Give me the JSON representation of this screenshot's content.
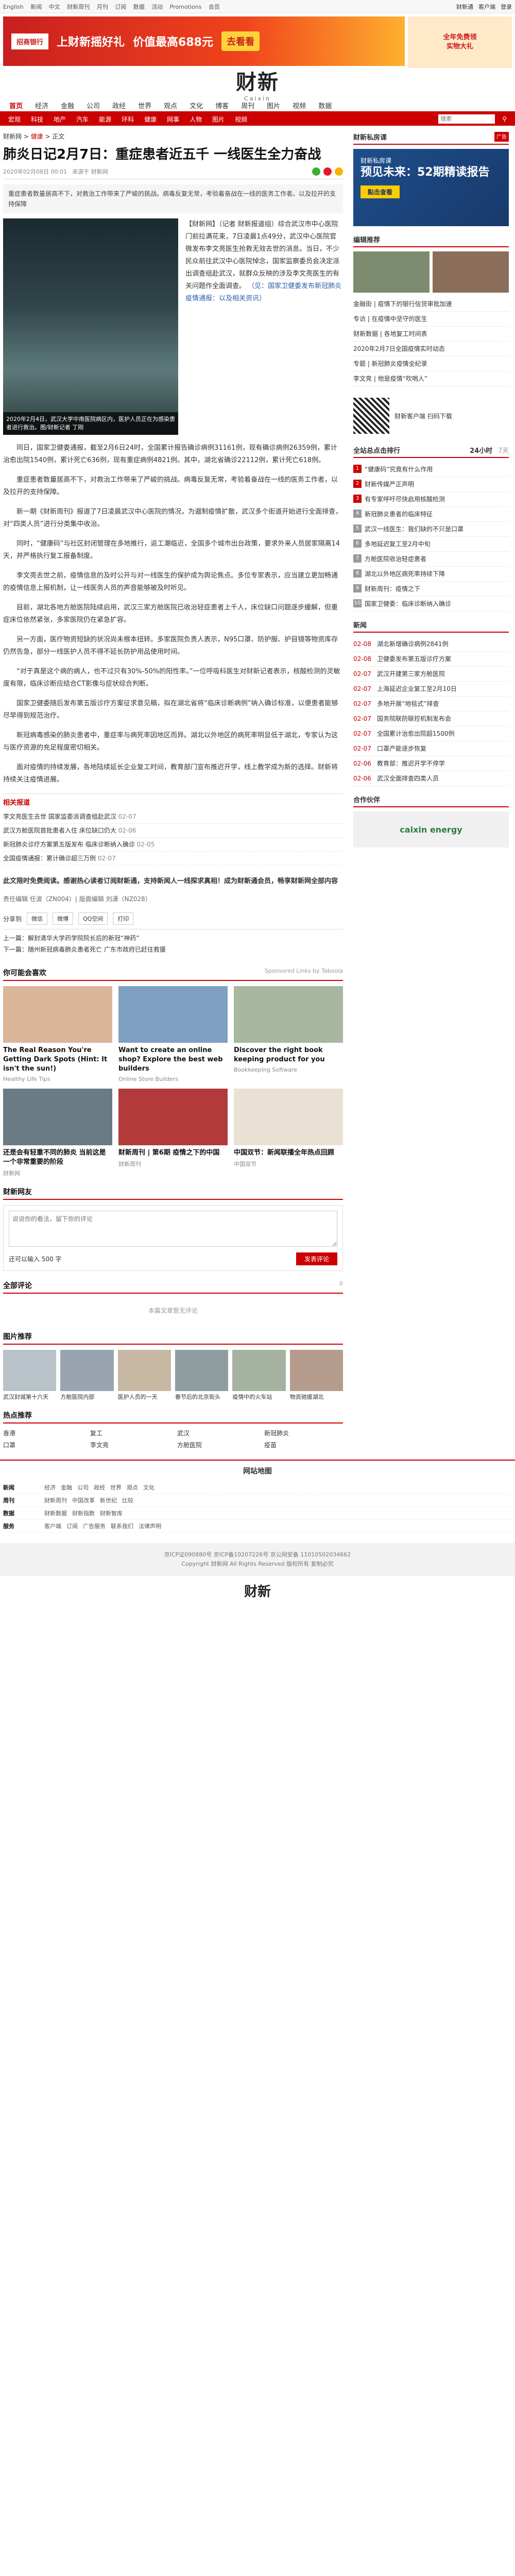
{
  "topbar": {
    "links": [
      "English",
      "新闻",
      "中文",
      "财新周刊",
      "月刊",
      "订阅",
      "数据",
      "活动",
      "Promotions",
      "会员",
      "登录"
    ],
    "right": [
      "财新通",
      "客户端",
      "登录"
    ]
  },
  "ad": {
    "bank": "招商银行",
    "slogan": "上财新摇好礼",
    "prize": "价值最高688元",
    "cta": "去看看",
    "right_line1": "全年免费领",
    "right_line2": "实物大礼"
  },
  "masthead": {
    "logo": "财新",
    "sub": "Caixin"
  },
  "nav1": {
    "items": [
      "首页",
      "经济",
      "金融",
      "公司",
      "政经",
      "世界",
      "观点",
      "文化",
      "博客",
      "周刊",
      "图片",
      "视频",
      "数据"
    ],
    "active": 0
  },
  "nav2": {
    "items": [
      "宏观",
      "科技",
      "地产",
      "汽车",
      "能源",
      "环科",
      "健康",
      "网事",
      "人物",
      "图片",
      "视频"
    ],
    "search_placeholder": "搜索"
  },
  "article": {
    "crumb_prefix": "财新网 > ",
    "crumb_section": "健康",
    "crumb_suffix": " > 正文",
    "title": "肺炎日记2月7日：重症患者近五千 一线医生全力奋战",
    "date": "2020年02月08日 00:01",
    "source": "来源于 财新网",
    "summary": "重症患者数量居高不下，对救治工作带来了严峻的挑战。病毒反复无常，考验着奋战在一线的医务工作者。以及拉开的支持保障",
    "photo_caption": "2020年2月4日，武汉大学中南医院病区内，医护人员正在为感染患者进行救治。图/财新记者 丁刚",
    "lead": "【财新网】（记者 财新报道组）综合武汉市中心医院门前拉满花束，7日凌晨1点49分，武汉中心医院官微发布李文亮医生抢救无效去世的消息。当日，不少民众前往武汉中心医院悼念，国家监察委员会决定派出调查组赴武汉，就群众反映的涉及李文亮医生的有关问题作全面调查。",
    "lead_link": "（见：国家卫健委发布新冠肺炎疫情通报：以及相关资讯）",
    "paras": [
      "同日，国家卫健委通报，截至2月6日24时，全国累计报告确诊病例31161例，现有确诊病例26359例，累计治愈出院1540例，累计死亡636例，现有重症病例4821例。其中，湖北省确诊22112例，累计死亡618例。",
      "重症患者数量居高不下，对救治工作带来了严峻的挑战。病毒反复无常，考验着奋战在一线的医务工作者，以及拉开的支持保障。",
      "新一期《财新周刊》报道了7日凌晨武汉中心医院的情况，为遏制疫情扩散，武汉多个街道开始进行全面排查，对“四类人员”进行分类集中收治。",
      "同时，“健康码”与社区封闭管理在多地推行，返工潮临近，全国多个城市出台政策，要求外来人员居家隔离14天，并严格执行复工报备制度。",
      "李文亮去世之前，疫情信息的及时公开与对一线医生的保护成为舆论焦点。多位专家表示，应当建立更加畅通的疫情信息上报机制，让一线医务人员的声音能够被及时听见。",
      "目前，湖北各地方舱医院陆续启用，武汉三家方舱医院已收治轻症患者上千人，床位缺口问题逐步缓解，但重症床位依然紧张，多家医院仍在紧急扩容。",
      "另一方面，医疗物资短缺的状况尚未根本扭转。多家医院负责人表示，N95口罩、防护服、护目镜等物资库存仍然告急，部分一线医护人员不得不延长防护用品使用时间。",
      "“对于真是这个病的病人，也不过只有30%-50%的阳性率。”一位呼吸科医生对财新记者表示，核酸检测的灵敏度有限，临床诊断应结合CT影像与症状综合判断。",
      "国家卫健委随后发布第五版诊疗方案征求意见稿，拟在湖北省将“临床诊断病例”纳入确诊标准，以便患者能够尽早得到规范治疗。",
      "新冠病毒感染的肺炎患者中，重症率与病死率因地区而异。湖北以外地区的病死率明显低于湖北，专家认为这与医疗资源的充足程度密切相关。",
      "面对疫情的持续发展，各地陆续延长企业复工时间，教育部门宣布推迟开学，线上教学成为新的选择。财新将持续关注疫情进展。"
    ],
    "related_title": "相关报道",
    "related": [
      {
        "t": "李文亮医生去世 国家监委派调查组赴武汉",
        "d": "02-07"
      },
      {
        "t": "武汉方舱医院首批患者入住 床位缺口仍大",
        "d": "02-06"
      },
      {
        "t": "新冠肺炎诊疗方案第五版发布 临床诊断纳入确诊",
        "d": "02-05"
      },
      {
        "t": "全国疫情通报：累计确诊超三万例",
        "d": "02-07"
      }
    ],
    "boldnote": "此文限时免费阅读。感谢热心读者订阅财新通，支持新闻人一线探求真相！成为财新通会员，畅享财新网全部内容",
    "editors": "责任编辑 任波（ZN004）| 版面编辑 刘潇（NZ028）",
    "prev": "上一篇：解封清华大学药学院院长后的新冠“神药”",
    "next": "下一篇：随州新冠病毒肺炎患者死亡 广东市政府已赶往救援"
  },
  "share": {
    "label": "分享到",
    "buttons": [
      "微信",
      "微博",
      "QQ空间",
      "打印"
    ]
  },
  "recommend": {
    "title": "你可能会喜欢",
    "sponsor": "Sponsored Links by Taboola",
    "cards": [
      {
        "t": "The Real Reason You're Getting Dark Spots (Hint: It isn't the sun!)",
        "s": "Healthy Life Tips"
      },
      {
        "t": "Want to create an online shop? Explore the best web builders",
        "s": "Online Store Builders"
      },
      {
        "t": "Discover the right book keeping product for you",
        "s": "Bookkeeping Software"
      },
      {
        "t": "还是会有轻重不同的肺炎 当前这是一个非常重要的阶段",
        "s": "财新网"
      },
      {
        "t": "财新周刊 | 第6期 疫情之下的中国",
        "s": "财新周刊"
      },
      {
        "t": "中国双节：新闻联播全年热点回顾",
        "s": "中国双节"
      }
    ]
  },
  "comment": {
    "title": "财新网友",
    "placeholder": "说说你的看法，留下你的评论",
    "hint": "还可以输入 500 字",
    "post": "发表评论",
    "empty": "本篇文章暂无评论",
    "header": "全部评论",
    "count": "0"
  },
  "pics": {
    "title": "图片推荐",
    "items": [
      "武汉封城第十六天",
      "方舱医院内部",
      "医护人员的一天",
      "春节后的北京街头",
      "疫情中的火车站",
      "物资驰援湖北"
    ]
  },
  "hot": {
    "title": "热点推荐",
    "items": [
      "香港",
      "复工",
      "武汉",
      "新冠肺炎",
      "口罩",
      "李文亮",
      "方舱医院",
      "疫苗"
    ]
  },
  "sitenav": {
    "title": "网站地图",
    "rows": [
      {
        "h": "新闻",
        "items": [
          "经济",
          "金融",
          "公司",
          "政经",
          "世界",
          "观点",
          "文化"
        ]
      },
      {
        "h": "周刊",
        "items": [
          "财新周刊",
          "中国改革",
          "新世纪",
          "比较"
        ]
      },
      {
        "h": "数据",
        "items": [
          "财新数据",
          "财新指数",
          "财新智库"
        ]
      },
      {
        "h": "服务",
        "items": [
          "客户端",
          "订阅",
          "广告服务",
          "联系我们",
          "法律声明"
        ]
      }
    ]
  },
  "footer": {
    "line1": "京ICP证090880号 京ICP备10207226号 京公网安备 11010502034662",
    "line2": "Copyright 财新网 All Rights Reserved 版权所有 复制必究"
  },
  "sidebar": {
    "ad_title": "财新私房课",
    "ad_tag": "广告",
    "ad_line1": "财新私房课",
    "ad_line2": "预见未来：52期精读报告",
    "ad_cta": "點击查看",
    "editor_title": "编辑推荐",
    "editor": [
      "金融街 | 疫情下的银行信贷审批加速",
      "专访 | 在疫情中坚守的医生",
      "财新数据 | 各地复工时间表",
      "2020年2月7日全国疫情实时动态",
      "专题 | 新冠肺炎疫情全纪录",
      "李文亮 | 他是疫情“吹哨人”"
    ],
    "qr_text": "财新客户端 扫码下载",
    "rank_title": "全站总点击排行",
    "rank_tabs": [
      "24小时",
      "7天"
    ],
    "rank": [
      "“健康码”究竟有什么作用",
      "财新传媒严正声明",
      "有专家呼吁尽快启用核酸检测",
      "新冠肺炎患者的临床特征",
      "武汉一线医生：我们缺的不只是口罩",
      "多地延迟复工至2月中旬",
      "方舱医院收治轻症患者",
      "湖北以外地区病死率持续下降",
      "财新周刊：疫情之下",
      "国家卫健委：临床诊断纳入确诊"
    ],
    "news_title": "新闻",
    "news": [
      {
        "t": "02-08",
        "c": "湖北新增确诊病例2841例"
      },
      {
        "t": "02-08",
        "c": "卫健委发布第五版诊疗方案"
      },
      {
        "t": "02-07",
        "c": "武汉开建第三家方舱医院"
      },
      {
        "t": "02-07",
        "c": "上海延迟企业复工至2月10日"
      },
      {
        "t": "02-07",
        "c": "多地开展“地毯式”排查"
      },
      {
        "t": "02-07",
        "c": "国务院联防联控机制发布会"
      },
      {
        "t": "02-07",
        "c": "全国累计治愈出院超1500例"
      },
      {
        "t": "02-07",
        "c": "口罩产能逐步恢复"
      },
      {
        "t": "02-06",
        "c": "教育部：推迟开学不停学"
      },
      {
        "t": "02-06",
        "c": "武汉全面排查四类人员"
      }
    ],
    "sponsor_title": "合作伙伴",
    "sponsor": "caixin energy"
  }
}
